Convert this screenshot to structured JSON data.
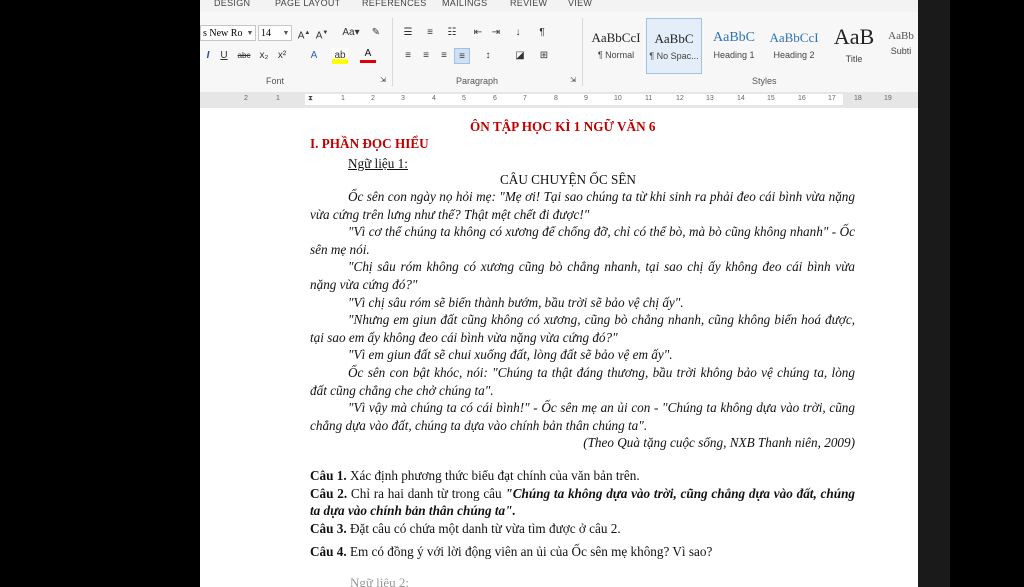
{
  "tabs": [
    "DESIGN",
    "PAGE LAYOUT",
    "REFERENCES",
    "MAILINGS",
    "REVIEW",
    "VIEW"
  ],
  "font": {
    "name": "s New Ro",
    "size": "14",
    "group_label": "Font"
  },
  "paragraph": {
    "group_label": "Paragraph"
  },
  "styles": {
    "group_label": "Styles",
    "items": [
      {
        "preview": "AaBbCcI",
        "name": "¶ Normal"
      },
      {
        "preview": "AaBbC",
        "name": "¶ No Spac..."
      },
      {
        "preview": "AaBbC",
        "name": "Heading 1"
      },
      {
        "preview": "AaBbCcI",
        "name": "Heading 2"
      },
      {
        "preview": "AaB",
        "name": "Title"
      },
      {
        "preview": "AaBb",
        "name": "Subti"
      }
    ]
  },
  "ruler_ticks": [
    "2",
    "1",
    "1",
    "1",
    "2",
    "3",
    "4",
    "5",
    "6",
    "7",
    "8",
    "9",
    "10",
    "11",
    "12",
    "13",
    "14",
    "15",
    "16",
    "17",
    "18",
    "19"
  ],
  "doc": {
    "title": "ÔN TẬP HỌC KÌ 1 NGỮ VĂN 6",
    "section": "I. PHẦN ĐỌC HIỂU",
    "ngu_lieu": "Ngữ liệu 1:",
    "story_title": "CÂU CHUYỆN ỐC SÊN",
    "paragraphs": [
      "Ốc sên con ngày nọ hỏi mẹ: \"Mẹ ơi! Tại sao chúng ta từ khi sinh ra phải đeo cái bình vừa nặng vừa cứng trên lưng như thế? Thật mệt chết đi được!\"",
      "\"Vì cơ thể chúng ta không có xương để chống đỡ, chỉ có thể bò, mà bò cũng không nhanh\" - Ốc sên mẹ nói.",
      "\"Chị sâu róm không có xương cũng bò chẳng nhanh, tại sao chị ấy không đeo cái bình vừa nặng vừa cứng đó?\"",
      "\"Vì chị sâu róm sẽ biến thành bướm, bầu trời sẽ bảo vệ chị ấy\".",
      "\"Nhưng em giun đất cũng không có xương, cũng bò chẳng nhanh, cũng không biến hoá được, tại sao em ấy không đeo cái bình vừa nặng vừa cứng đó?\"",
      "\"Vì em giun đất sẽ chui xuống đất, lòng đất sẽ bảo vệ em ấy\".",
      "Ốc sên con bật khóc, nói: \"Chúng ta thật đáng thương, bầu trời không bảo vệ chúng ta, lòng đất cũng chẳng che chở chúng ta\".",
      "\"Vì vậy mà chúng ta có cái bình!\" - Ốc sên mẹ an ủi con - \"Chúng ta không dựa vào trời, cũng chẳng dựa vào đất, chúng ta dựa vào chính bản thân chúng ta\"."
    ],
    "source": "(Theo Quà tặng cuộc sống, NXB Thanh niên, 2009)",
    "questions": [
      {
        "label": "Câu 1.",
        "text": " Xác định phương thức biểu đạt chính của văn bản trên."
      },
      {
        "label": "Câu 2.",
        "text": " Chỉ ra hai danh từ trong câu ",
        "emph": "\"Chúng ta không dựa vào trời, cũng chẳng dựa vào đất, chúng ta dựa vào chính bản thân chúng ta\"."
      },
      {
        "label": "Câu 3.",
        "text": " Đặt câu có chứa một danh từ vừa tìm được ở câu 2."
      },
      {
        "label": "Câu 4.",
        "text": " Em có đồng ý với lời động viên an ủi của Ốc sên mẹ không? Vì sao?"
      }
    ],
    "cutoff_text": "Ngữ liệu 2:"
  }
}
